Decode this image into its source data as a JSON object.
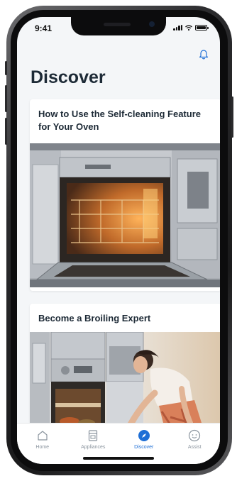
{
  "status": {
    "time": "9:41"
  },
  "page": {
    "title": "Discover"
  },
  "cards": [
    {
      "title": "How to Use the Self-cleaning Feature for Your Oven"
    },
    {
      "title": "Become a Broiling Expert"
    }
  ],
  "tabs": [
    {
      "label": "Home",
      "icon": "home-icon"
    },
    {
      "label": "Appliances",
      "icon": "appliance-icon"
    },
    {
      "label": "Discover",
      "icon": "compass-icon",
      "active": true
    },
    {
      "label": "Assist",
      "icon": "assist-icon"
    }
  ],
  "colors": {
    "accent": "#1f6fd6",
    "background": "#f4f6f8",
    "title": "#1d2a36",
    "inactive": "#8a949e"
  }
}
